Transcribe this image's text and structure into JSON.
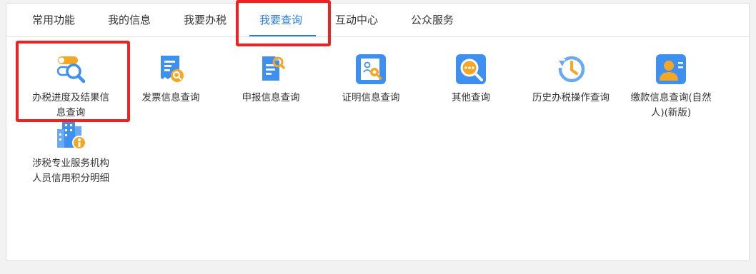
{
  "tabs": [
    {
      "label": "常用功能"
    },
    {
      "label": "我的信息"
    },
    {
      "label": "我要办税"
    },
    {
      "label": "我要查询"
    },
    {
      "label": "互动中心"
    },
    {
      "label": "公众服务"
    }
  ],
  "active_tab": "我要查询",
  "items": [
    {
      "label_line1": "办税进度及结果信",
      "label_line2": "息查询",
      "icon": "search-progress-icon"
    },
    {
      "label_line1": "发票信息查询",
      "label_line2": "",
      "icon": "invoice-search-icon"
    },
    {
      "label_line1": "申报信息查询",
      "label_line2": "",
      "icon": "declaration-search-icon"
    },
    {
      "label_line1": "证明信息查询",
      "label_line2": "",
      "icon": "certificate-search-icon"
    },
    {
      "label_line1": "其他查询",
      "label_line2": "",
      "icon": "other-search-icon"
    },
    {
      "label_line1": "历史办税操作查询",
      "label_line2": "",
      "icon": "history-icon"
    },
    {
      "label_line1": "缴款信息查询(自然",
      "label_line2": "人)(新版)",
      "icon": "payment-person-icon"
    },
    {
      "label_line1": "涉税专业服务机构",
      "label_line2": "人员信用积分明细",
      "icon": "agency-credit-icon"
    }
  ],
  "colors": {
    "accent": "#2b7bdc",
    "highlight": "#ee2222",
    "icon_blue": "#3d8ff0",
    "icon_orange": "#f5a623"
  }
}
